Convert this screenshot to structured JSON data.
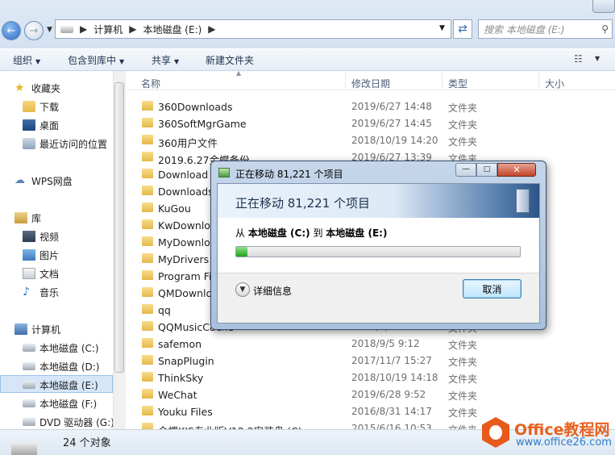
{
  "address_bar": {
    "path": [
      "计算机",
      "本地磁盘 (E:)"
    ],
    "search_placeholder": "搜索 本地磁盘 (E:)"
  },
  "toolbar": {
    "organize": "组织",
    "include_in_library": "包含到库中",
    "share": "共享",
    "new_folder": "新建文件夹"
  },
  "sidebar": {
    "favorites": "收藏夹",
    "downloads": "下载",
    "desktop": "桌面",
    "recent": "最近访问的位置",
    "wps": "WPS网盘",
    "libraries": "库",
    "videos": "视频",
    "pictures": "图片",
    "documents": "文档",
    "music": "音乐",
    "computer": "计算机",
    "drive_c": "本地磁盘 (C:)",
    "drive_d": "本地磁盘 (D:)",
    "drive_e": "本地磁盘 (E:)",
    "drive_f": "本地磁盘 (F:)",
    "drive_g": "DVD 驱动器 (G:)"
  },
  "columns": {
    "name": "名称",
    "date": "修改日期",
    "type": "类型",
    "size": "大小"
  },
  "files": [
    {
      "name": "360Downloads",
      "date": "2019/6/27 14:48",
      "type": "文件夹"
    },
    {
      "name": "360SoftMgrGame",
      "date": "2019/6/27 14:45",
      "type": "文件夹"
    },
    {
      "name": "360用户文件",
      "date": "2018/10/19 14:20",
      "type": "文件夹"
    },
    {
      "name": "2019.6.27金蝶备份",
      "date": "2019/6/27 13:39",
      "type": "文件夹"
    },
    {
      "name": "Download",
      "date": "",
      "type": ""
    },
    {
      "name": "Downloads",
      "date": "",
      "type": ""
    },
    {
      "name": "KuGou",
      "date": "",
      "type": ""
    },
    {
      "name": "KwDownloa",
      "date": "",
      "type": ""
    },
    {
      "name": "MyDownloa",
      "date": "",
      "type": ""
    },
    {
      "name": "MyDrivers",
      "date": "",
      "type": ""
    },
    {
      "name": "Program Fi",
      "date": "",
      "type": ""
    },
    {
      "name": "QMDownlo",
      "date": "",
      "type": ""
    },
    {
      "name": "qq",
      "date": "",
      "type": ""
    },
    {
      "name": "QQMusicCache",
      "date": "2016/2/26 13:31",
      "type": "文件夹"
    },
    {
      "name": "safemon",
      "date": "2018/9/5 9:12",
      "type": "文件夹"
    },
    {
      "name": "SnapPlugin",
      "date": "2017/11/7 15:27",
      "type": "文件夹"
    },
    {
      "name": "ThinkSky",
      "date": "2018/10/19 14:18",
      "type": "文件夹"
    },
    {
      "name": "WeChat",
      "date": "2019/6/28 9:52",
      "type": "文件夹"
    },
    {
      "name": "Youku Files",
      "date": "2016/8/31 14:17",
      "type": "文件夹"
    },
    {
      "name": "金蝶KIS专业版V12.2安装盘 (C)",
      "date": "2015/6/16 10:53",
      "type": "文件夹"
    }
  ],
  "status": {
    "count": "24 个对象"
  },
  "dialog": {
    "title": "正在移动 81,221 个项目",
    "heading": "正在移动 81,221 个项目",
    "from_word": "从",
    "source": "本地磁盘 (C:)",
    "to_word": "到",
    "destination": "本地磁盘 (E:)",
    "progress": 0.04,
    "details": "详细信息",
    "cancel": "取消"
  },
  "watermark": {
    "title": "Office教程网",
    "url": "www.office26.com"
  }
}
